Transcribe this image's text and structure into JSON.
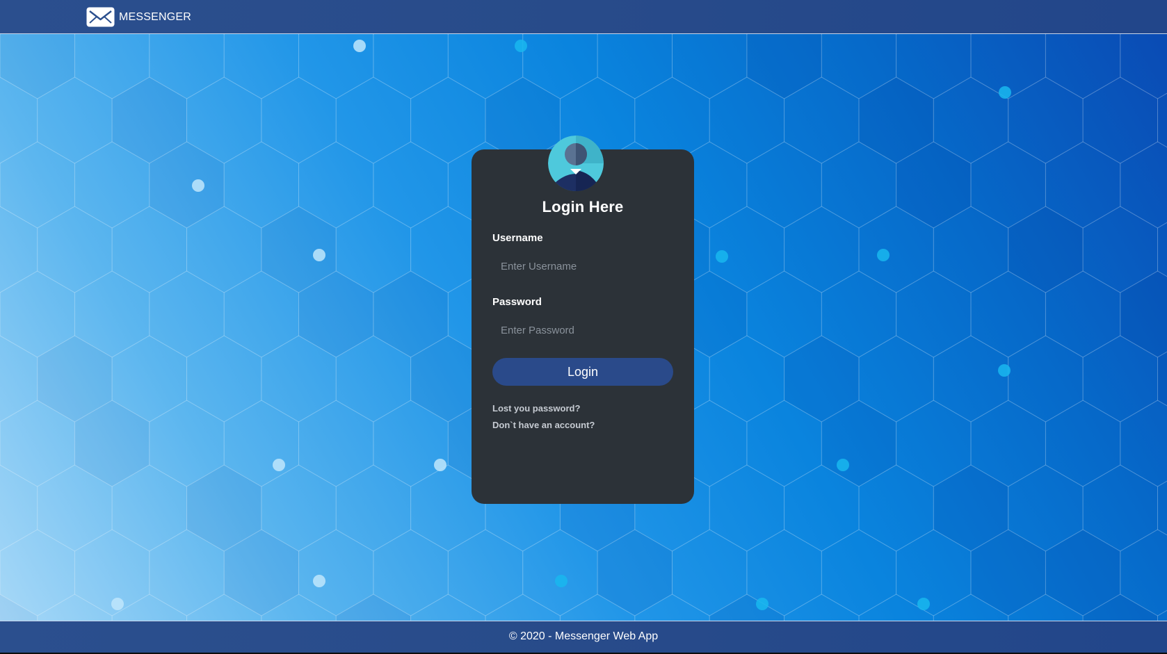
{
  "app": {
    "brand_label": "MESSENGER",
    "brand_icon": "envelope-icon"
  },
  "login": {
    "title": "Login Here",
    "avatar_icon": "user-avatar-icon",
    "username_label": "Username",
    "username_placeholder": "Enter Username",
    "username_value": "",
    "password_label": "Password",
    "password_placeholder": "Enter Password",
    "password_value": "",
    "submit_label": "Login",
    "lost_password_link": "Lost you password?",
    "signup_link": "Don`t have an account?"
  },
  "footer": {
    "text": "© 2020 - Messenger Web App"
  },
  "colors": {
    "header_bg": "#284b8a",
    "card_bg": "#2c3238",
    "button_bg": "#2a4a8a",
    "avatar_teal": "#4ec9dc",
    "avatar_navy": "#1d2f63",
    "hero_light": "#a7d8f7",
    "hero_dark": "#0a4bb4"
  }
}
